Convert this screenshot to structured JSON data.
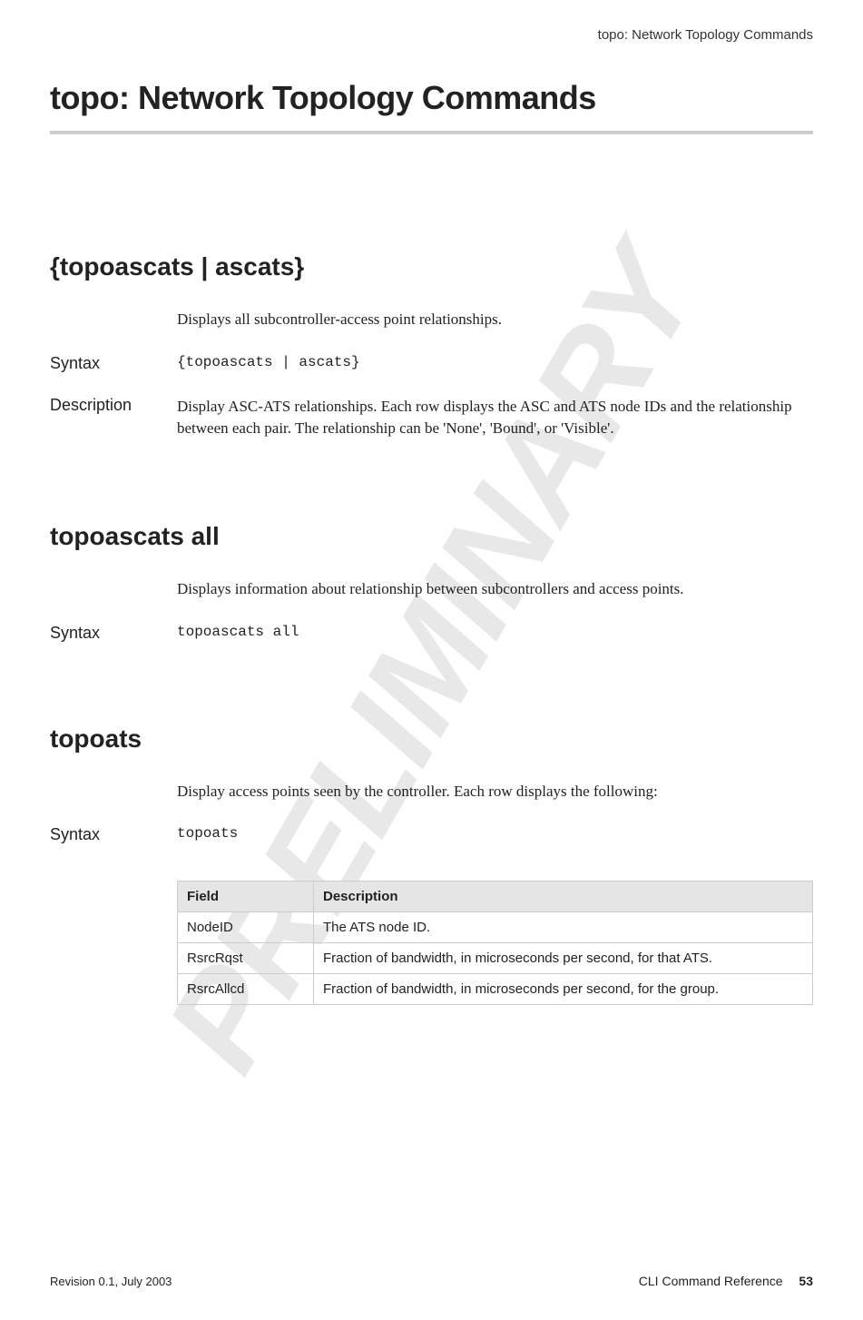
{
  "header": {
    "running_title": "topo: Network Topology Commands"
  },
  "watermark": "PRELIMINARY",
  "chapter_title": "topo: Network Topology Commands",
  "commands": [
    {
      "name": "{topoascats | ascats}",
      "summary": "Displays all subcontroller-access point relationships.",
      "syntax_label": "Syntax",
      "syntax": "{topoascats | ascats}",
      "description_label": "Description",
      "description": "Display ASC-ATS relationships. Each row displays the ASC and ATS node IDs and the relationship between each pair. The relationship can be 'None', 'Bound', or 'Visible'."
    },
    {
      "name": "topoascats all",
      "summary": "Displays information about relationship between subcontrollers and access points.",
      "syntax_label": "Syntax",
      "syntax": "topoascats all"
    },
    {
      "name": "topoats",
      "summary": "Display access points seen by the controller. Each row displays the following:",
      "syntax_label": "Syntax",
      "syntax": "topoats",
      "table": {
        "headers": [
          "Field",
          "Description"
        ],
        "rows": [
          [
            "NodeID",
            "The ATS node ID."
          ],
          [
            "RsrcRqst",
            "Fraction of bandwidth, in microseconds per second, for that ATS."
          ],
          [
            "RsrcAllcd",
            "Fraction of bandwidth, in microseconds per second, for the group."
          ]
        ]
      }
    }
  ],
  "footer": {
    "left": "Revision 0.1, July 2003",
    "right_label": "CLI Command Reference",
    "page_number": "53"
  }
}
